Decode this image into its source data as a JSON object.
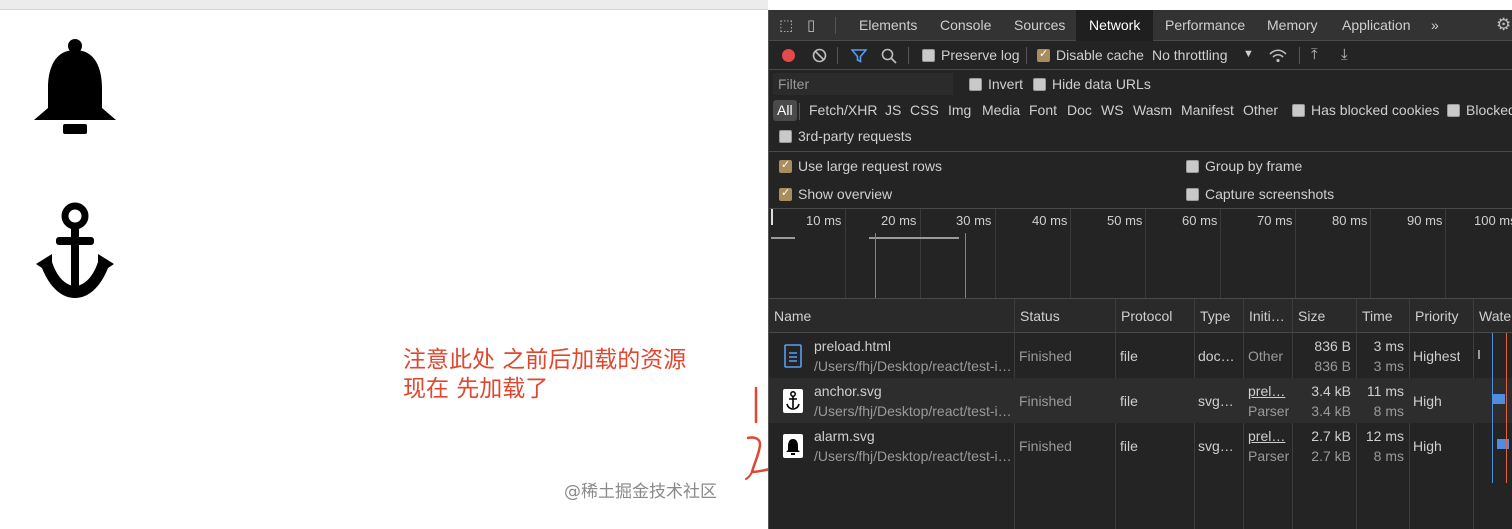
{
  "page": {
    "annotation_line1": "注意此处 之前后加载的资源",
    "annotation_line2": "现在 先加载了"
  },
  "devtools": {
    "tabs": [
      "Elements",
      "Console",
      "Sources",
      "Network",
      "Performance",
      "Memory",
      "Application"
    ],
    "active_tab": "Network",
    "more_tabs": "»",
    "toolbar": {
      "preserve_log": "Preserve log",
      "disable_cache": "Disable cache",
      "throttling": "No throttling",
      "throttling_caret": "▼"
    },
    "filter": {
      "placeholder": "Filter",
      "invert": "Invert",
      "hide_data_urls": "Hide data URLs"
    },
    "types": [
      "All",
      "Fetch/XHR",
      "JS",
      "CSS",
      "Img",
      "Media",
      "Font",
      "Doc",
      "WS",
      "Wasm",
      "Manifest",
      "Other"
    ],
    "has_blocked_cookies": "Has blocked cookies",
    "blocked_requests": "Blocked",
    "third_party": "3rd-party requests",
    "options": {
      "large_rows": "Use large request rows",
      "group_by_frame": "Group by frame",
      "show_overview": "Show overview",
      "capture_screenshots": "Capture screenshots"
    },
    "overview_ticks": [
      "10 ms",
      "20 ms",
      "30 ms",
      "40 ms",
      "50 ms",
      "60 ms",
      "70 ms",
      "80 ms",
      "90 ms",
      "100 ms"
    ],
    "columns": [
      "Name",
      "Status",
      "Protocol",
      "Type",
      "Initi…",
      "Size",
      "Time",
      "Priority",
      "Waterf"
    ],
    "requests": [
      {
        "name": "preload.html",
        "path": "/Users/fhj/Desktop/react/test-i…",
        "status": "Finished",
        "protocol": "file",
        "type": "doc…",
        "initiator": "Other",
        "initiator_sub": "",
        "size": "836 B",
        "size_sub": "836 B",
        "time": "3 ms",
        "time_sub": "3 ms",
        "priority": "Highest"
      },
      {
        "name": "anchor.svg",
        "path": "/Users/fhj/Desktop/react/test-i…",
        "status": "Finished",
        "protocol": "file",
        "type": "svg…",
        "initiator": "prel…",
        "initiator_sub": "Parser",
        "size": "3.4 kB",
        "size_sub": "3.4 kB",
        "time": "11 ms",
        "time_sub": "8 ms",
        "priority": "High"
      },
      {
        "name": "alarm.svg",
        "path": "/Users/fhj/Desktop/react/test-i…",
        "status": "Finished",
        "protocol": "file",
        "type": "svg…",
        "initiator": "prel…",
        "initiator_sub": "Parser",
        "size": "2.7 kB",
        "size_sub": "2.7 kB",
        "time": "12 ms",
        "time_sub": "8 ms",
        "priority": "High"
      }
    ]
  },
  "watermark": "@稀土掘金技术社区",
  "colors": {
    "annotation": "#e0472f",
    "devtools_bg": "#242424",
    "accent_blue": "#4f8de0"
  }
}
